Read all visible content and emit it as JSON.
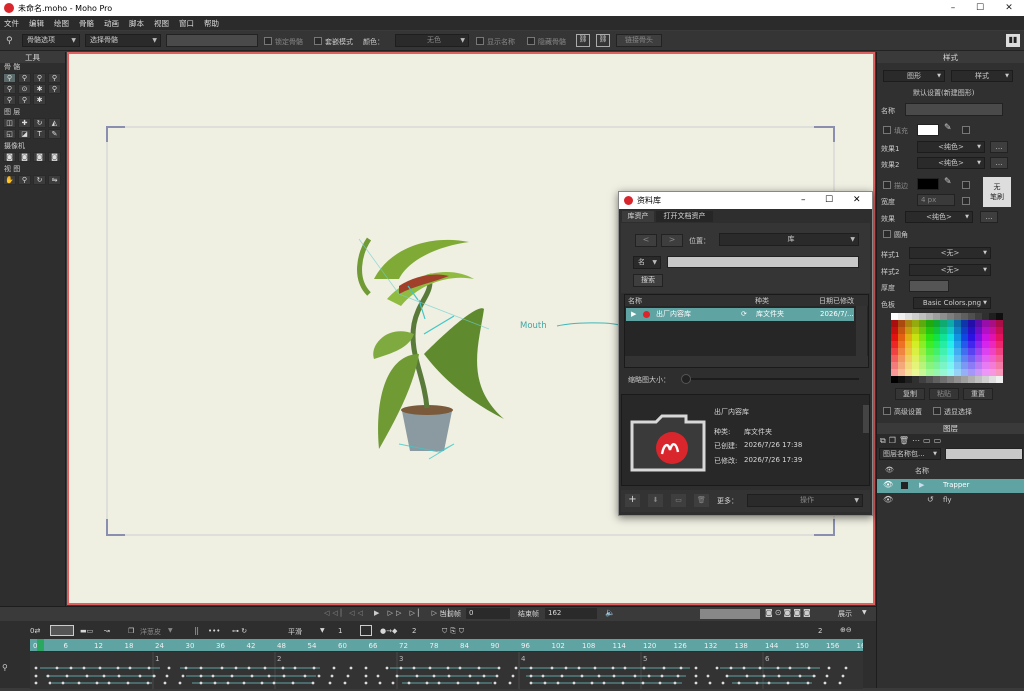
{
  "window": {
    "title": "未命名.moho - Moho Pro",
    "minimize": "–",
    "maximize": "☐",
    "close": "✕"
  },
  "menu": [
    "文件",
    "编辑",
    "绘图",
    "骨骼",
    "动画",
    "脚本",
    "视图",
    "窗口",
    "帮助"
  ],
  "options_bar": {
    "bone_options": "骨骼选项",
    "select_bone": "选择骨骼",
    "lock_bone": "锁定骨骼",
    "nest_mode": "套嵌模式",
    "color_label": "颜色：",
    "color_value": "无色",
    "show_names": "显示名称",
    "hide_bones": "隐藏骨骼",
    "link_bones": "链接骨头"
  },
  "tools": {
    "header": "工具",
    "sections": [
      "骨 骼",
      "图 层",
      "摄像机",
      "视 图"
    ]
  },
  "canvas": {
    "bone_label": "Mouth"
  },
  "library": {
    "title": "资料库",
    "tabs": [
      "库资产",
      "打开文档资产"
    ],
    "location_label": "位置：",
    "location_value": "库",
    "name_label": "名",
    "search_button": "搜索",
    "columns": [
      "名称",
      "种类",
      "日期已修改"
    ],
    "rows": [
      {
        "name": "出厂内容库",
        "kind": "库文件夹",
        "date": "2026/7/..."
      }
    ],
    "thumb_label": "缩略图大小：",
    "detail": {
      "name": "出厂内容库",
      "kind_label": "种类:",
      "kind": "库文件夹",
      "created_label": "已创建:",
      "created": "2026/7/26 17:38",
      "modified_label": "已修改:",
      "modified": "2026/7/26 17:39"
    },
    "more_label": "更多：",
    "action_value": "操作"
  },
  "style_panel": {
    "header": "样式",
    "shape_dd": "图形",
    "style_dd": "样式",
    "default_label": "默认设置(新建图形)",
    "name_label": "名称",
    "fill_label": "填充",
    "effect1_label": "效果1",
    "effect1_value": "<纯色>",
    "effect2_label": "效果2",
    "effect2_value": "<纯色>",
    "stroke_label": "描边",
    "no_brush_button": "无\n笔刷",
    "width_label": "宽度",
    "width_value": "4 px",
    "effect_label": "效果",
    "effect_value": "<纯色>",
    "round_label": "圆角",
    "style1_label": "样式1",
    "style1_value": "<无>",
    "style2_label": "样式2",
    "style2_value": "<无>",
    "thickness_label": "厚度",
    "palette_label": "色板",
    "palette_value": "Basic Colors.png",
    "copy_button": "复制",
    "paste_button": "粘贴",
    "reset_button": "重置",
    "advanced_label": "高级设置",
    "select_through_label": "透显选择",
    "fill_color": "#ffffff",
    "stroke_color": "#000000"
  },
  "layers_panel": {
    "header": "图层",
    "filter_value": "图层名称包...",
    "name_col": "名称",
    "layers": [
      {
        "name": "Trapper"
      },
      {
        "name": "fly"
      }
    ]
  },
  "timeline": {
    "current_frame_label": "当前帧",
    "current_frame": "0",
    "end_frame_label": "结束帧",
    "end_frame": "162",
    "display_label": "展示",
    "onion_label": "洋葱皮",
    "interp_value": "平滑",
    "interp_count": "1",
    "keys_count": "2",
    "zoom_value": "2",
    "ruler": [
      "0",
      "6",
      "12",
      "18",
      "24",
      "30",
      "36",
      "42",
      "48",
      "54",
      "60",
      "66",
      "72",
      "78",
      "84",
      "90",
      "96",
      "102",
      "108",
      "114",
      "120",
      "126",
      "132",
      "138",
      "144",
      "150",
      "156",
      "16"
    ],
    "seconds": [
      "1",
      "2",
      "3",
      "4",
      "5",
      "6"
    ]
  },
  "colors": {
    "accent": "#5fa3a3",
    "canvas_bg": "#efefe2",
    "canvas_border": "#e06060",
    "brand": "#d9262c"
  }
}
